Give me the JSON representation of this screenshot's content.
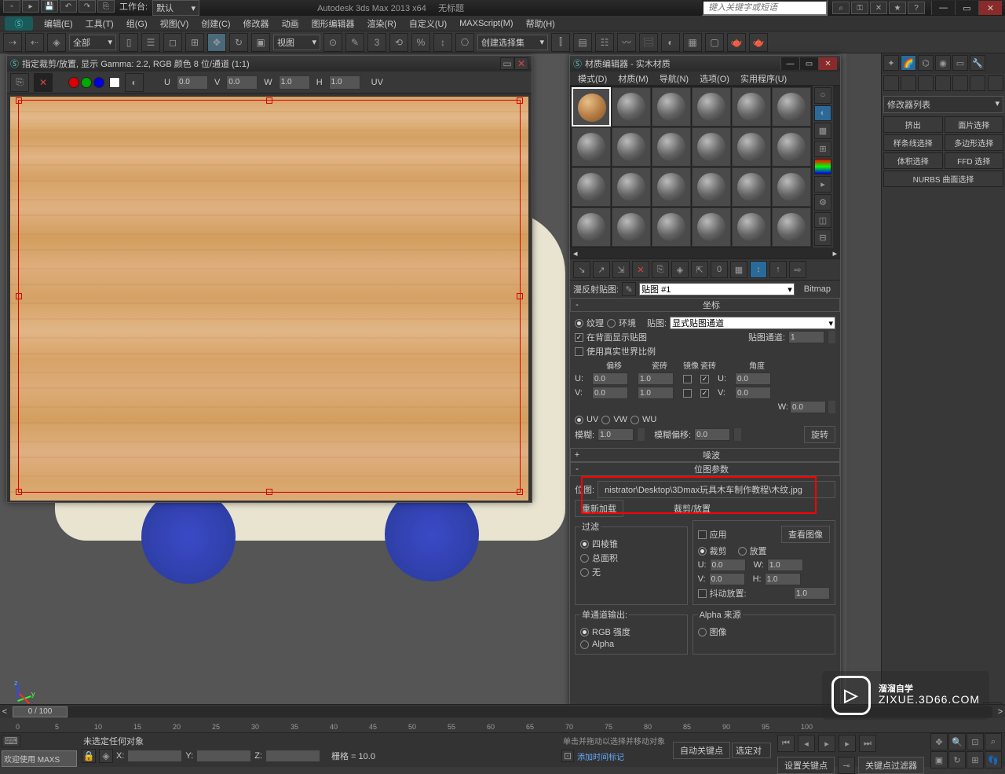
{
  "titlebar": {
    "app": "Autodesk 3ds Max  2013 x64",
    "doc": "无标题",
    "search_ph": "键入关键字或短语",
    "workspace_label": "工作台:",
    "workspace_value": "默认"
  },
  "menus": [
    "编辑(E)",
    "工具(T)",
    "组(G)",
    "视图(V)",
    "创建(C)",
    "修改器",
    "动画",
    "图形编辑器",
    "渲染(R)",
    "自定义(U)",
    "MAXScript(M)",
    "帮助(H)"
  ],
  "toolbar": {
    "all": "全部",
    "view": "视图",
    "create_sel": "创建选择集"
  },
  "bitmap_win": {
    "title": "指定裁剪/放置, 显示 Gamma: 2.2, RGB 颜色 8 位/通道 (1:1)",
    "u": "0.0",
    "v": "0.0",
    "w": "1.0",
    "h": "1.0",
    "uv": "UV"
  },
  "mat_editor": {
    "title": "材质编辑器 - 实木材质",
    "menus": [
      "模式(D)",
      "材质(M)",
      "导航(N)",
      "选项(O)",
      "实用程序(U)"
    ],
    "diffuse_label": "漫反射贴图:",
    "map_name": "贴图 #1",
    "map_type": "Bitmap",
    "coords": {
      "header": "坐标",
      "texture": "纹理",
      "env": "环境",
      "map_lbl": "贴图:",
      "map_val": "显式贴图通道",
      "back": "在背面显示贴图",
      "real": "使用真实世界比例",
      "chan_lbl": "贴图通道:",
      "chan_val": "1",
      "offset": "偏移",
      "tile": "瓷砖",
      "mirror": "镜像",
      "tile2": "瓷砖",
      "angle": "角度",
      "u": "U:",
      "v": "V:",
      "w": "W:",
      "u_off": "0.0",
      "v_off": "0.0",
      "u_tile": "1.0",
      "v_tile": "1.0",
      "u_ang": "0.0",
      "v_ang": "0.0",
      "w_ang": "0.0",
      "uv": "UV",
      "vw": "VW",
      "wu": "WU",
      "blur_lbl": "模糊:",
      "blur": "1.0",
      "bluroff_lbl": "模糊偏移:",
      "bluroff": "0.0",
      "rotate": "旋转"
    },
    "noise": {
      "header": "噪波"
    },
    "bitmap_params": {
      "header": "位图参数",
      "path_lbl": "位图:",
      "path": "nistrator\\Desktop\\3Dmax玩具木车制作教程\\木纹.jpg",
      "reload": "重新加载",
      "crop_place": "裁剪/放置",
      "apply": "应用",
      "view": "查看图像",
      "crop": "裁剪",
      "place": "放置",
      "filter": "过滤",
      "pyramid": "四棱锥",
      "sat": "总面积",
      "none": "无",
      "u": "U:",
      "v": "V:",
      "w": "W:",
      "h": "H:",
      "uv": "0.0",
      "vv": "0.0",
      "wv": "1.0",
      "hv": "1.0",
      "jitter": "抖动放置:",
      "jitter_v": "1.0",
      "mono": "单通道输出:",
      "rgb_int": "RGB 强度",
      "alpha": "Alpha",
      "alpha_src": "Alpha 来源",
      "img_alpha": "图像"
    }
  },
  "right_panel": {
    "mod_list": "修改器列表",
    "btns": [
      "挤出",
      "面片选择",
      "样条线选择",
      "多边形选择",
      "体积选择",
      "FFD 选择"
    ],
    "nurbs": "NURBS 曲面选择"
  },
  "timeline": {
    "frame": "0 / 100"
  },
  "ruler": [
    "0",
    "5",
    "10",
    "15",
    "20",
    "25",
    "30",
    "35",
    "40",
    "45",
    "50",
    "55",
    "60",
    "65",
    "70",
    "75",
    "80",
    "85",
    "90",
    "95",
    "100"
  ],
  "status": {
    "welcome": "欢迎使用  MAXS",
    "no_sel": "未选定任何对象",
    "drag_hint": "单击并拖动以选择并移动对象",
    "add_time": "添加时间标记",
    "x": "X:",
    "y": "Y:",
    "z": "Z:",
    "grid_lbl": "栅格 = ",
    "grid": "10.0",
    "autokey": "自动关键点",
    "setkey": "设置关键点",
    "sel_dd": "选定对",
    "keyfilter": "关键点过滤器"
  },
  "watermark": {
    "brand": "溜溜自学",
    "url": "ZIXUE.3D66.COM"
  }
}
